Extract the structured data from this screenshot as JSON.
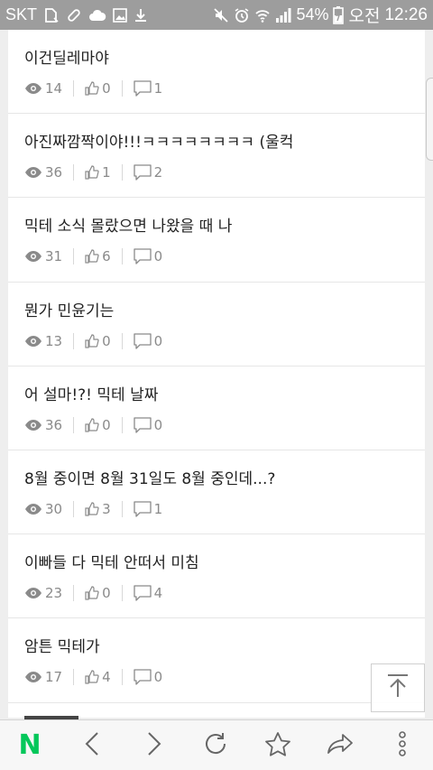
{
  "status_bar": {
    "carrier": "SKT",
    "battery": "54%",
    "time_prefix": "오전",
    "time": "12:26",
    "icons": [
      "sim-card-icon",
      "link-icon",
      "cloud-icon",
      "image-icon",
      "download-icon",
      "mute-icon",
      "alarm-icon",
      "wifi-icon",
      "signal-icon",
      "battery-charging-icon"
    ]
  },
  "posts": [
    {
      "title": "이건딜레마야",
      "views": "14",
      "likes": "0",
      "comments": "1"
    },
    {
      "title": "아진짜깜짝이야!!!ㅋㅋㅋㅋㅋㅋㅋㅋ (울컥",
      "views": "36",
      "likes": "1",
      "comments": "2"
    },
    {
      "title": "믹테 소식 몰랐으면 나왔을 때 나",
      "views": "31",
      "likes": "6",
      "comments": "0"
    },
    {
      "title": "뭔가 민윤기는",
      "views": "13",
      "likes": "0",
      "comments": "0"
    },
    {
      "title": "어 설마!?! 믹테 날짜",
      "views": "36",
      "likes": "0",
      "comments": "0"
    },
    {
      "title": "8월 중이면 8월 31일도 8월 중인데...?",
      "views": "30",
      "likes": "3",
      "comments": "1"
    },
    {
      "title": "이빠들 다 믹테 안떠서 미침",
      "views": "23",
      "likes": "0",
      "comments": "4"
    },
    {
      "title": "암튼 믹테가",
      "views": "17",
      "likes": "4",
      "comments": "0"
    }
  ],
  "meta_icons": {
    "views": "eye-icon",
    "likes": "thumbs-up-icon",
    "comments": "comment-icon"
  },
  "top_button": {
    "icon": "scroll-to-top-icon"
  },
  "nav": {
    "brand_letter": "N",
    "brand_color": "#03c75a",
    "buttons": [
      "naver-home-button",
      "back-button",
      "forward-button",
      "refresh-button",
      "bookmark-button",
      "share-button",
      "more-menu-button"
    ]
  }
}
